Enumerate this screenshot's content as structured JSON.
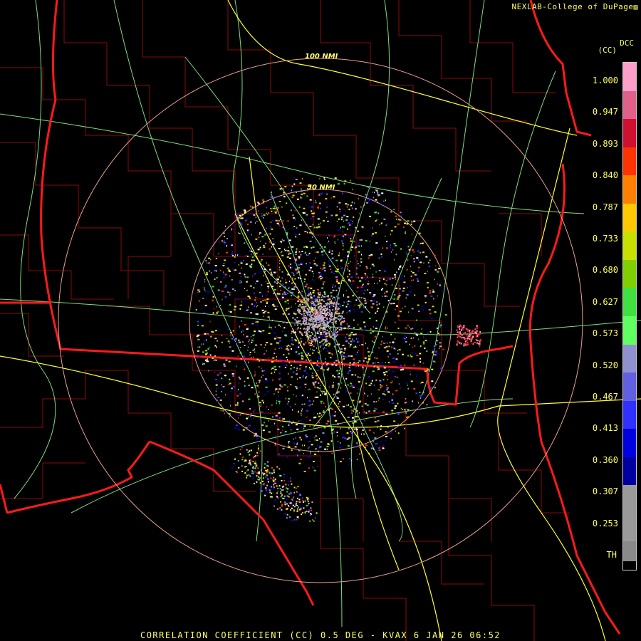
{
  "credit": "NEXLAB-College of DuPage",
  "product_code": "DCC",
  "units": "(CC)",
  "range_rings": [
    "100 NMI",
    "50 NMI"
  ],
  "colorbar": {
    "labels": [
      "1.000",
      "0.947",
      "0.893",
      "0.840",
      "0.787",
      "0.733",
      "0.680",
      "0.627",
      "0.573",
      "0.520",
      "0.467",
      "0.413",
      "0.360",
      "0.307",
      "0.253",
      "TH"
    ],
    "colors": [
      "#ff9ec8",
      "#e0608a",
      "#d01030",
      "#ff3300",
      "#ff8000",
      "#ffc800",
      "#c8e000",
      "#80d000",
      "#40e040",
      "#60ff60",
      "#9090d0",
      "#6060e0",
      "#3030ff",
      "#0000e0",
      "#0000a0",
      "#9a9a9a",
      "#9a9a9a",
      "#8a8a8a"
    ]
  },
  "footer": "CORRELATION COEFFICIENT (CC) 0.5 DEG - KVAX 6 JAN 26 06:52",
  "icons": [
    "logo-icon"
  ]
}
